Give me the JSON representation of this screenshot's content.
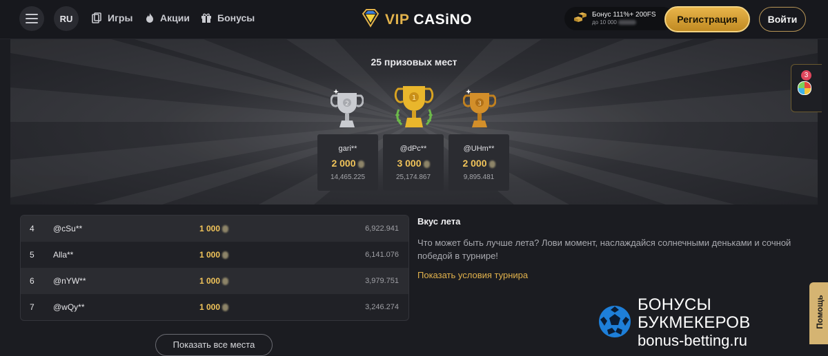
{
  "header": {
    "lang": "RU",
    "nav": [
      {
        "label": "Игры",
        "icon": "games-icon"
      },
      {
        "label": "Акции",
        "icon": "fire-icon"
      },
      {
        "label": "Бонусы",
        "icon": "gift-icon"
      }
    ],
    "logo": {
      "vip": "VIP",
      "casino": "CASiNO"
    },
    "bonus": {
      "line1": "Бонус 111%+ 200FS",
      "line2": "до 10 000"
    },
    "register_label": "Регистрация",
    "login_label": "Войти"
  },
  "hero": {
    "title": "25 призовых мест",
    "podium": [
      {
        "place": "2",
        "name": "gari**",
        "amount": "2 000",
        "score": "14,465.225"
      },
      {
        "place": "1",
        "name": "@dPc**",
        "amount": "3 000",
        "score": "25,174.867"
      },
      {
        "place": "3",
        "name": "@UHm**",
        "amount": "2 000",
        "score": "9,895.481"
      }
    ]
  },
  "side_panel": {
    "badge": "3"
  },
  "leaderboard": {
    "rows": [
      {
        "rank": "4",
        "name": "@cSu**",
        "amount": "1 000",
        "score": "6,922.941"
      },
      {
        "rank": "5",
        "name": "Alla**",
        "amount": "1 000",
        "score": "6,141.076"
      },
      {
        "rank": "6",
        "name": "@nYW**",
        "amount": "1 000",
        "score": "3,979.751"
      },
      {
        "rank": "7",
        "name": "@wQy**",
        "amount": "1 000",
        "score": "3,246.274"
      }
    ],
    "show_all_label": "Показать все места"
  },
  "tournament": {
    "title": "Вкус лета",
    "description": "Что может быть лучше лета? Лови момент, наслаждайся солнечными деньками и сочной победой в турнире!",
    "conditions_link": "Показать условия турнира"
  },
  "help_label": "Помощь",
  "watermark": {
    "line1": "БОНУСЫ БУКМЕКЕРОВ",
    "line2": "bonus-betting.ru"
  },
  "colors": {
    "accent_gold": "#e3b34c",
    "background": "#1b1c21",
    "panel": "#2b2c31"
  }
}
